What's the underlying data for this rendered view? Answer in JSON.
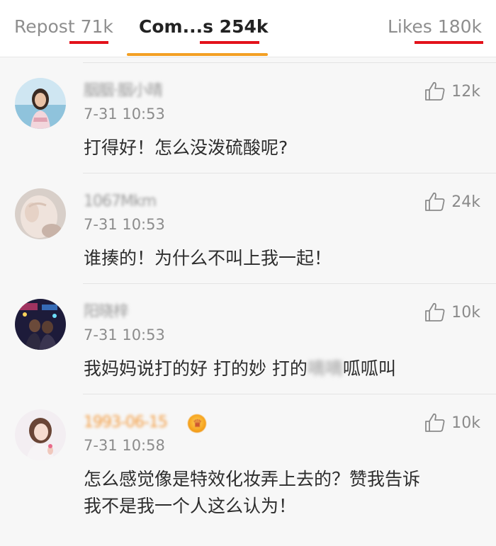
{
  "tabs": {
    "repost": {
      "label": "Repost",
      "count": "71k"
    },
    "comments": {
      "label": "Com...s",
      "count": "254k"
    },
    "likes": {
      "label": "Likes",
      "count": "180k"
    }
  },
  "colors": {
    "active_tab_indicator": "#f3a024",
    "annotation_underline": "#e3121b",
    "vip_name": "#f39a3c"
  },
  "comments": [
    {
      "username": "胭胭·胭小晴",
      "time": "7-31 10:53",
      "likes": "12k",
      "text": "打得好！怎么没泼硫酸呢?",
      "like_icon": "thumbs-up-icon"
    },
    {
      "username": "1067Mkm",
      "time": "7-31 10:53",
      "likes": "24k",
      "text": "谁揍的！为什么不叫上我一起！",
      "like_icon": "thumbs-up-icon"
    },
    {
      "username": "阳晓梓",
      "time": "7-31 10:53",
      "likes": "10k",
      "text_before": "我妈妈说打的好 打的妙 打的",
      "text_blurred": "嘀嘀",
      "text_after": "呱呱叫",
      "like_icon": "thumbs-up-icon"
    },
    {
      "username": "1993-06-15",
      "time": "7-31 10:58",
      "likes": "10k",
      "text_line1": "怎么感觉像是特效化妆弄上去的？赞我告诉",
      "text_line2": "我不是我一个人这么认为！",
      "badge_icon": "vip-crown-icon",
      "like_icon": "thumbs-up-icon"
    }
  ]
}
